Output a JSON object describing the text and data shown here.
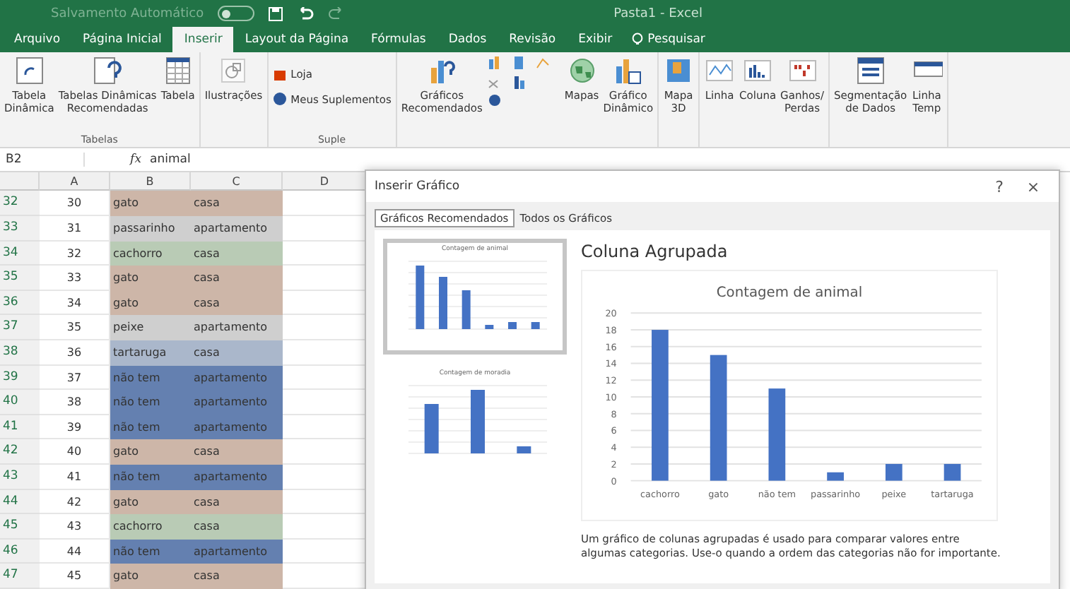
{
  "titlebar": {
    "autosave": {
      "label": "Salvamento Automático",
      "on": false
    },
    "title": "Pasta1 - Excel"
  },
  "tabs": [
    {
      "label": "Arquivo",
      "selected": false
    },
    {
      "label": "Página Inicial",
      "selected": false
    },
    {
      "label": "Inserir",
      "selected": true
    },
    {
      "label": "Layout da Página",
      "selected": false
    },
    {
      "label": "Fórmulas",
      "selected": false
    },
    {
      "label": "Dados",
      "selected": false
    },
    {
      "label": "Revisão",
      "selected": false
    },
    {
      "label": "Exibir",
      "selected": false
    }
  ],
  "search": {
    "label": "Pesquisar"
  },
  "ribbon": {
    "groups": [
      {
        "label": "Tabelas",
        "buttons": [
          {
            "kind": "pivot",
            "label": "Tabela\nDinâmica"
          },
          {
            "kind": "recpivot",
            "label": "Tabelas Dinâmicas\nRecomendadas"
          },
          {
            "kind": "table",
            "label": "Tabela"
          }
        ]
      },
      {
        "buttons": [
          {
            "kind": "shapes",
            "label": "Ilustrações"
          }
        ]
      },
      {
        "label": "Suple",
        "addins": [
          {
            "kind": "store",
            "label": "Loja"
          },
          {
            "kind": "addin",
            "label": "Meus Suplementos"
          }
        ]
      },
      {
        "buttons": [
          {
            "kind": "recchart",
            "label": "Gráficos\nRecomendados"
          },
          {
            "kind": "chartgrid"
          },
          {
            "kind": "globe",
            "label": "Mapas"
          },
          {
            "kind": "pivotchart",
            "label": "Gráfico\nDinâmico"
          }
        ]
      },
      {
        "buttons": [
          {
            "kind": "map3d",
            "label": "Mapa\n3D"
          }
        ]
      },
      {
        "buttons": [
          {
            "kind": "sparkline",
            "label": "Linha"
          },
          {
            "kind": "sparkcol",
            "label": "Coluna"
          },
          {
            "kind": "winloss",
            "label": "Ganhos/\nPerdas"
          }
        ]
      },
      {
        "buttons": [
          {
            "kind": "slicer",
            "label": "Segmentação\nde Dados"
          },
          {
            "kind": "timeline",
            "label": "Linha\nTemp"
          }
        ]
      }
    ]
  },
  "formula_bar": {
    "cell": "B2",
    "fx": "fx",
    "value": "animal"
  },
  "sheet": {
    "columns": [
      "A",
      "B",
      "C",
      "D"
    ],
    "rows": [
      {
        "n": "32",
        "a": "30",
        "b": "gato",
        "c": "casa",
        "color": "#cdb6a8"
      },
      {
        "n": "33",
        "a": "31",
        "b": "passarinho",
        "c": "apartamento",
        "color": "#cfcfcf"
      },
      {
        "n": "34",
        "a": "32",
        "b": "cachorro",
        "c": "casa",
        "color": "#b9cbb5"
      },
      {
        "n": "35",
        "a": "33",
        "b": "gato",
        "c": "casa",
        "color": "#cdb6a8"
      },
      {
        "n": "36",
        "a": "34",
        "b": "gato",
        "c": "casa",
        "color": "#cdb6a8"
      },
      {
        "n": "37",
        "a": "35",
        "b": "peixe",
        "c": "apartamento",
        "color": "#cfcfcf"
      },
      {
        "n": "38",
        "a": "36",
        "b": "tartaruga",
        "c": "casa",
        "color": "#aab7cb"
      },
      {
        "n": "39",
        "a": "37",
        "b": "não tem",
        "c": "apartamento",
        "color": "#6480b0"
      },
      {
        "n": "40",
        "a": "38",
        "b": "não tem",
        "c": "apartamento",
        "color": "#6480b0"
      },
      {
        "n": "41",
        "a": "39",
        "b": "não tem",
        "c": "apartamento",
        "color": "#6480b0"
      },
      {
        "n": "42",
        "a": "40",
        "b": "gato",
        "c": "casa",
        "color": "#cdb6a8"
      },
      {
        "n": "43",
        "a": "41",
        "b": "não tem",
        "c": "apartamento",
        "color": "#6480b0"
      },
      {
        "n": "44",
        "a": "42",
        "b": "gato",
        "c": "casa",
        "color": "#cdb6a8"
      },
      {
        "n": "45",
        "a": "43",
        "b": "cachorro",
        "c": "casa",
        "color": "#b9cbb5"
      },
      {
        "n": "46",
        "a": "44",
        "b": "não tem",
        "c": "apartamento",
        "color": "#6480b0"
      },
      {
        "n": "47",
        "a": "45",
        "b": "gato",
        "c": "casa",
        "color": "#cdb6a8"
      }
    ]
  },
  "dialog": {
    "title": "Inserir Gráfico",
    "help": "?",
    "close": "×",
    "tabs": [
      {
        "label": "Gráficos Recomendados",
        "selected": true
      },
      {
        "label": "Todos os Gráficos",
        "selected": false
      }
    ],
    "thumbnails": [
      {
        "title": "Contagem de animal",
        "selected": true
      },
      {
        "title": "Contagem de moradia",
        "selected": false
      }
    ],
    "chart_name": "Coluna Agrupada",
    "chart_data": {
      "type": "bar",
      "title": "Contagem de animal",
      "categories": [
        "cachorro",
        "gato",
        "não tem",
        "passarinho",
        "peixe",
        "tartaruga"
      ],
      "series": [
        {
          "color": "#4472c4",
          "values": [
            18,
            15,
            11,
            1,
            2,
            2
          ]
        }
      ],
      "grid": true,
      "ylim": [
        0,
        20
      ],
      "yticks": [
        0,
        2,
        4,
        6,
        8,
        10,
        12,
        14,
        16,
        18,
        20
      ]
    },
    "description": "Um gráfico de colunas agrupadas é usado para comparar valores entre algumas categorias. Use-o quando a ordem das categorias não for importante."
  }
}
